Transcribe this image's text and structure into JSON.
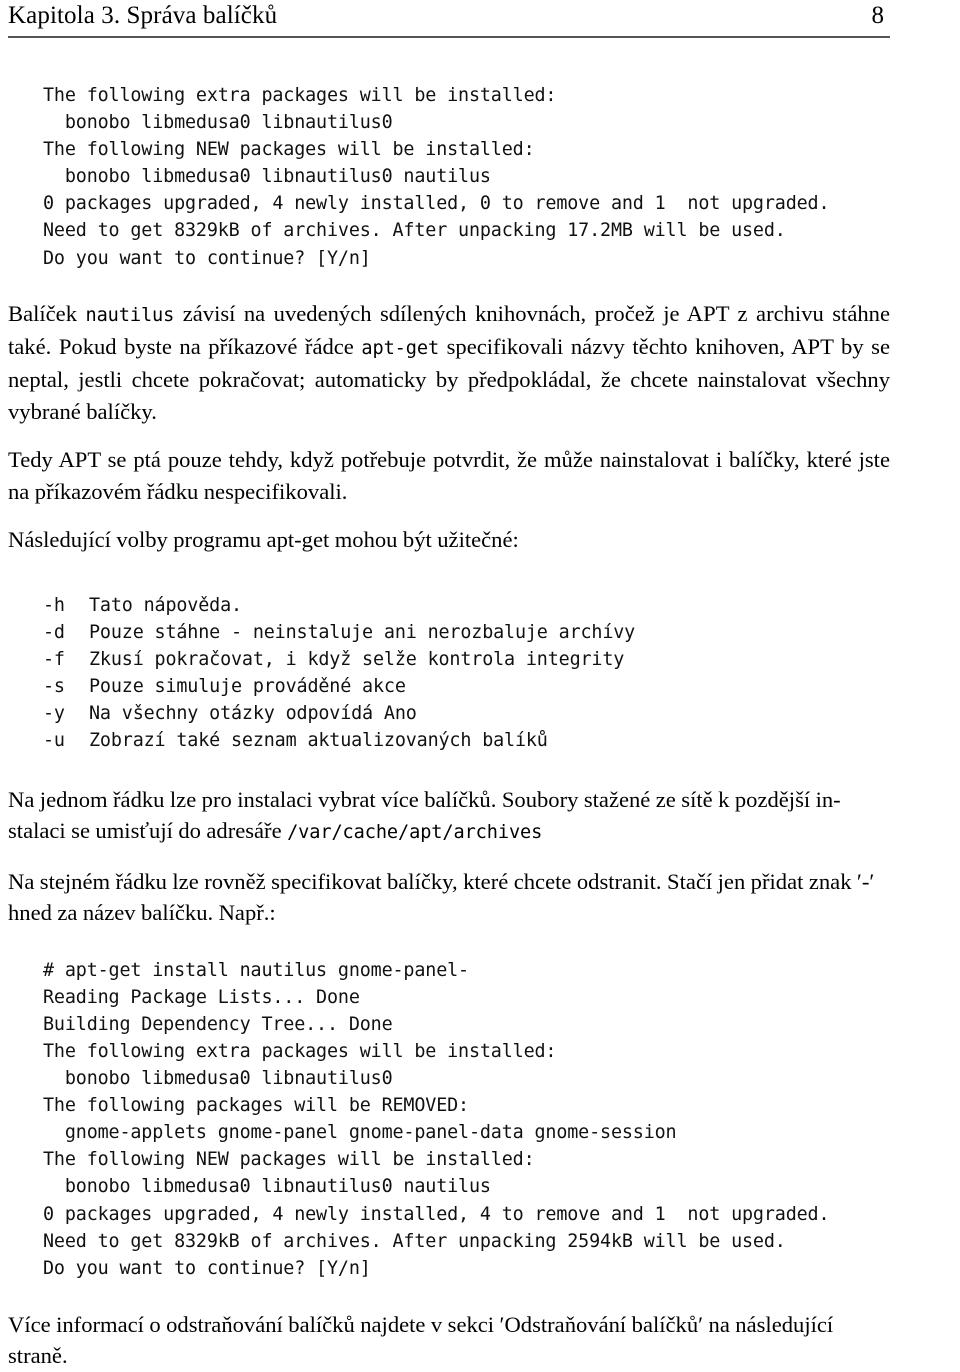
{
  "header": {
    "title": "Kapitola 3. Správa balíčků",
    "page_number": "8"
  },
  "blocks": {
    "code_block_1": "The following extra packages will be installed:\n  bonobo libmedusa0 libnautilus0\nThe following NEW packages will be installed:\n  bonobo libmedusa0 libnautilus0 nautilus\n0 packages upgraded, 4 newly installed, 0 to remove and 1  not upgraded.\nNeed to get 8329kB of archives. After unpacking 17.2MB will be used.\nDo you want to continue? [Y/n]",
    "para_1": {
      "part1": "Balíček ",
      "code1": "nautilus",
      "part2": " závisí na uvedených sdílených knihovnách, pročež je APT z archivu stáhne také. Pokud byste na příkazové řádce ",
      "code2": "apt-get",
      "part3": " specifikovali názvy těchto knihoven, APT by se neptal, jestli chcete pokračovat; automaticky by předpokládal, že chcete nainstalovat všechny vybrané balíčky."
    },
    "para_2": "Tedy APT se ptá pouze tehdy, když potřebuje potvrdit, že může nainstalovat i balíčky, které jste na příkazovém řádku nespecifikovali.",
    "para_3": "Následující volby programu apt-get mohou být užitečné:",
    "options": [
      {
        "flag": "-h",
        "description": "Tato nápověda."
      },
      {
        "flag": "-d",
        "description": "Pouze stáhne - neinstaluje ani nerozbaluje archívy"
      },
      {
        "flag": "-f",
        "description": "Zkusí pokračovat, i když selže kontrola integrity"
      },
      {
        "flag": "-s",
        "description": "Pouze simuluje prováděné akce"
      },
      {
        "flag": "-y",
        "description": "Na všechny otázky odpovídá Ano"
      },
      {
        "flag": "-u",
        "description": "Zobrazí také seznam aktualizovaných balíků"
      }
    ],
    "para_4": {
      "part1": "Na jednom řádku lze pro instalaci vybrat více balíčků. Soubory stažené ze sítě k pozdější in-stalaci se umisťují do adresáře ",
      "code1": "/var/cache/apt/archives"
    },
    "para_5": "Na stejném řádku lze rovněž specifikovat balíčky, které chcete odstranit. Stačí jen přidat znak ′-′ hned za název balíčku. Např.:",
    "code_block_2": "# apt-get install nautilus gnome-panel-\nReading Package Lists... Done\nBuilding Dependency Tree... Done\nThe following extra packages will be installed:\n  bonobo libmedusa0 libnautilus0\nThe following packages will be REMOVED:\n  gnome-applets gnome-panel gnome-panel-data gnome-session\nThe following NEW packages will be installed:\n  bonobo libmedusa0 libnautilus0 nautilus\n0 packages upgraded, 4 newly installed, 4 to remove and 1  not upgraded.\nNeed to get 8329kB of archives. After unpacking 2594kB will be used.\nDo you want to continue? [Y/n]",
    "para_6": "Více informací o odstraňování balíčků najdete v sekci ′Odstraňování balíčků′ na následující straně."
  }
}
